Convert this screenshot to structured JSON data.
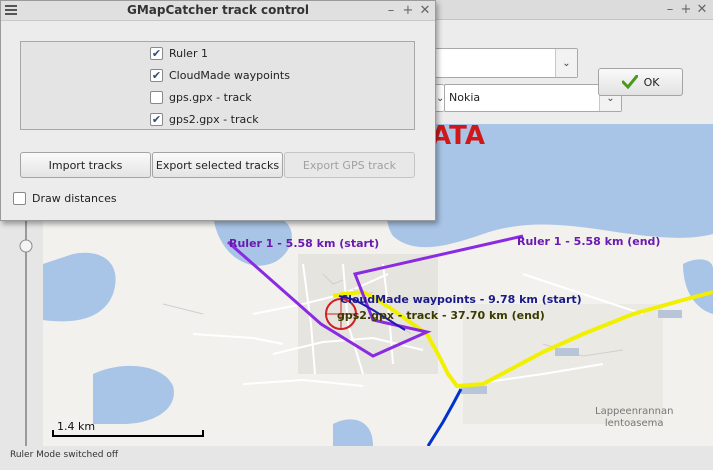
{
  "dialog": {
    "title": "GMapCatcher track control",
    "tracks": [
      {
        "label": "Ruler 1",
        "checked": true
      },
      {
        "label": "CloudMade waypoints",
        "checked": true
      },
      {
        "label": "gps.gpx - track",
        "checked": false
      },
      {
        "label": "gps2.gpx - track",
        "checked": true
      }
    ],
    "buttons": {
      "import": "Import tracks",
      "export_selected": "Export selected tracks",
      "export_gps": "Export GPS track"
    },
    "draw_distances": {
      "label": "Draw distances",
      "checked": false
    }
  },
  "main": {
    "ok_label": "OK",
    "map_service_value": "Nokia"
  },
  "map": {
    "brand_partial": "ATA",
    "labels": {
      "ruler_start": "Ruler 1 - 5.58 km (start)",
      "ruler_end": "Ruler 1 - 5.58 km (end)",
      "cloudmade_start": "CloudMade waypoints - 9.78 km (start)",
      "gps2_end": "gps2.gpx - track - 37.70 km (end)"
    },
    "place_line1": "Lappeenrannan",
    "place_line2": "lentoasema",
    "scale": "1.4 km"
  },
  "status": "Ruler Mode switched off",
  "colors": {
    "ruler": "#8a2be2",
    "cloudmade": "#1a1ab0",
    "gps2": "#f0f000",
    "gps": "#0033cc",
    "water": "#a8c4e6"
  }
}
